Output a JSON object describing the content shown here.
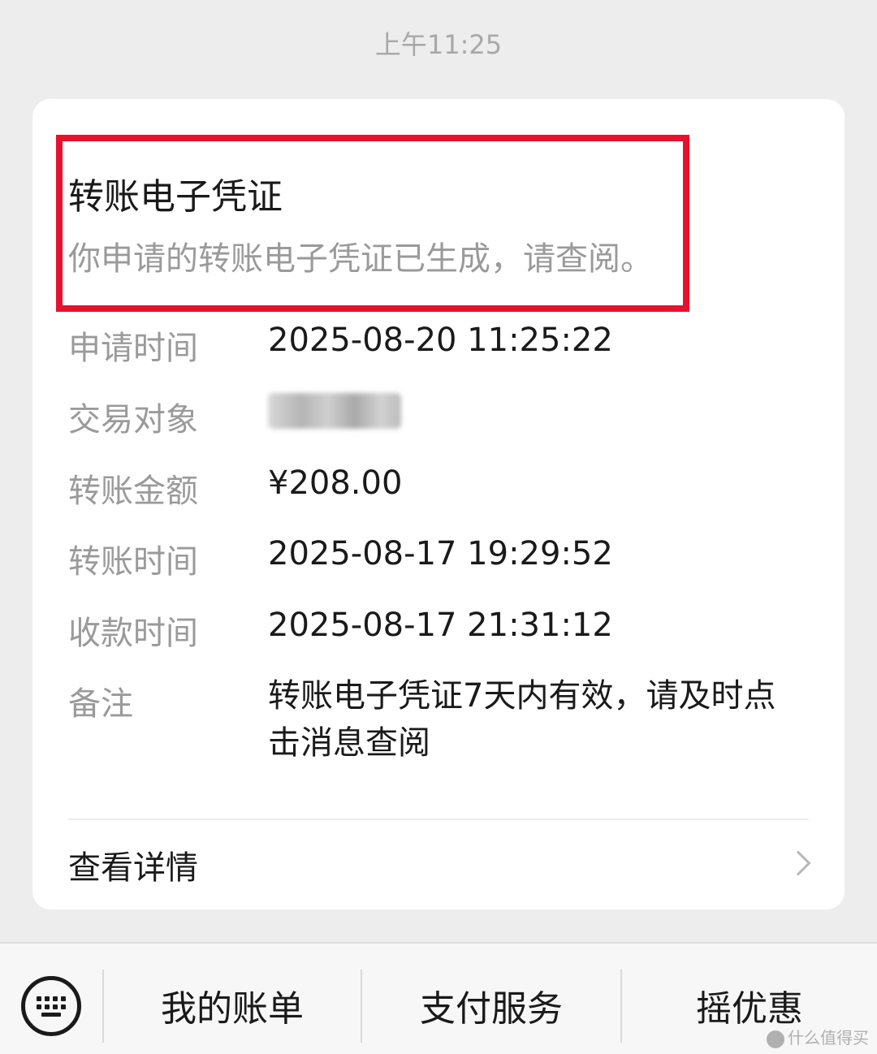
{
  "timestamp": "上午11:25",
  "card": {
    "title": "转账电子凭证",
    "subtitle": "你申请的转账电子凭证已生成，请查阅。",
    "rows": [
      {
        "label": "申请时间",
        "value": "2025-08-20 11:25:22"
      },
      {
        "label": "交易对象",
        "value": ""
      },
      {
        "label": "转账金额",
        "value": "¥208.00"
      },
      {
        "label": "转账时间",
        "value": "2025-08-17 19:29:52"
      },
      {
        "label": "收款时间",
        "value": "2025-08-17 21:31:12"
      },
      {
        "label": "备注",
        "value": "转账电子凭证7天内有效，请及时点击消息查阅"
      }
    ],
    "details_label": "查看详情"
  },
  "bottom_menu": {
    "items": [
      "我的账单",
      "支付服务",
      "摇优惠"
    ]
  },
  "watermark": "什么值得买",
  "colors": {
    "highlight_border": "#e8112d",
    "background": "#ededed",
    "card": "#ffffff"
  }
}
